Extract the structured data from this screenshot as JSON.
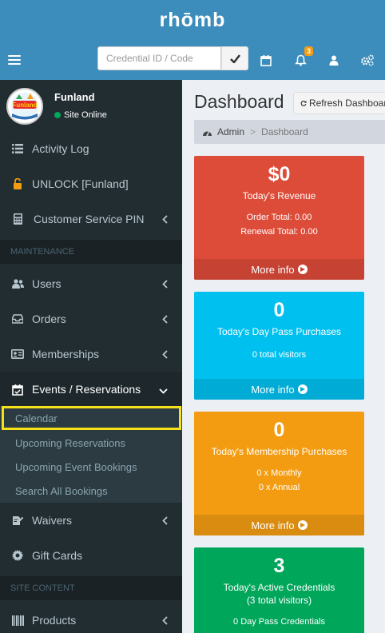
{
  "app": {
    "logo": "rhōmb"
  },
  "navbar": {
    "credential_placeholder": "Credential ID / Code",
    "notification_count": "3"
  },
  "user": {
    "name": "Funland",
    "status": "Site Online",
    "logo_text": "Funland"
  },
  "sidebar": {
    "activity_log": "Activity Log",
    "unlock": "UNLOCK [Funland]",
    "customer_service_pin": "Customer Service PIN",
    "header_maintenance": "MAINTENANCE",
    "users": "Users",
    "orders": "Orders",
    "memberships": "Memberships",
    "events_reservations": "Events / Reservations",
    "submenu": {
      "calendar": "Calendar",
      "upcoming_reservations": "Upcoming Reservations",
      "upcoming_event_bookings": "Upcoming Event Bookings",
      "search_all_bookings": "Search All Bookings"
    },
    "waivers": "Waivers",
    "gift_cards": "Gift Cards",
    "header_site_content": "SITE CONTENT",
    "products": "Products"
  },
  "content": {
    "title": "Dashboard",
    "refresh_label": "Refresh Dashboard",
    "breadcrumb_home": "Admin",
    "breadcrumb_current": "Dashboard"
  },
  "boxes": {
    "revenue": {
      "value": "$0",
      "label": "Today's Revenue",
      "order_total": "Order Total: 0.00",
      "renewal_total": "Renewal Total: 0.00",
      "more": "More info"
    },
    "day_pass": {
      "value": "0",
      "label": "Today's Day Pass Purchases",
      "visitors": "0 total visitors",
      "more": "More info"
    },
    "membership": {
      "value": "0",
      "label": "Today's Membership Purchases",
      "monthly": "0 x Monthly",
      "annual": "0 x Annual",
      "more": "More info"
    },
    "credentials": {
      "value": "3",
      "label": "Today's Active Credentials",
      "visitors": "(3 total visitors)",
      "day_pass_credentials": "0 Day Pass Credentials"
    }
  },
  "colors": {
    "header": "#3c8dbc",
    "sidebar": "#222d32",
    "red": "#dd4b39",
    "aqua": "#00c0ef",
    "yellow": "#f39c12",
    "green": "#00a65a",
    "highlight": "#f5e11a"
  }
}
